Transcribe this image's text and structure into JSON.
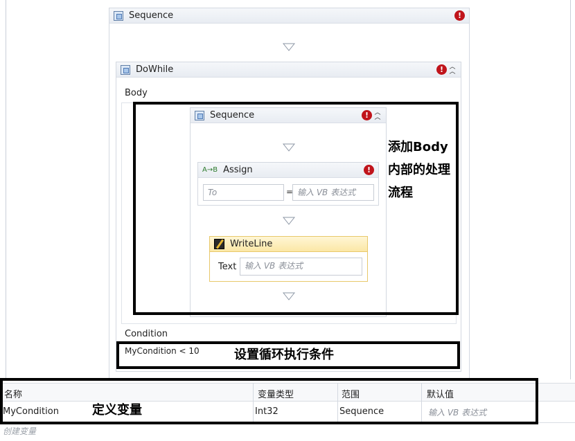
{
  "outer_sequence": {
    "title": "Sequence"
  },
  "dowhile": {
    "title": "DoWhile",
    "body_label": "Body",
    "condition_label": "Condition",
    "condition_value": "MyCondition < 10"
  },
  "inner_sequence": {
    "title": "Sequence"
  },
  "assign": {
    "title": "Assign",
    "to_placeholder": "To",
    "equals": "=",
    "value_placeholder": "输入 VB 表达式"
  },
  "writeline": {
    "title": "WriteLine",
    "text_label": "Text",
    "text_placeholder": "输入 VB 表达式"
  },
  "annotations": {
    "body_note": [
      "添加Body",
      "内部的处理",
      "流程"
    ],
    "condition_note": "设置循环执行条件",
    "variable_note": "定义变量"
  },
  "variables": {
    "headers": {
      "name": "名称",
      "type": "变量类型",
      "scope": "范围",
      "default": "默认值"
    },
    "rows": [
      {
        "name": "MyCondition",
        "type": "Int32",
        "scope": "Sequence",
        "default_placeholder": "输入 VB 表达式"
      }
    ],
    "create_label": "创建变量"
  },
  "icons": {
    "activity": "sequence-icon",
    "error": "error-icon",
    "collapse": "collapse-icon",
    "drop": "drop-arrow-icon"
  },
  "colors": {
    "error_red": "#c0141b",
    "writeline_header": "#fbe7a6",
    "annotation_border": "#000000"
  }
}
